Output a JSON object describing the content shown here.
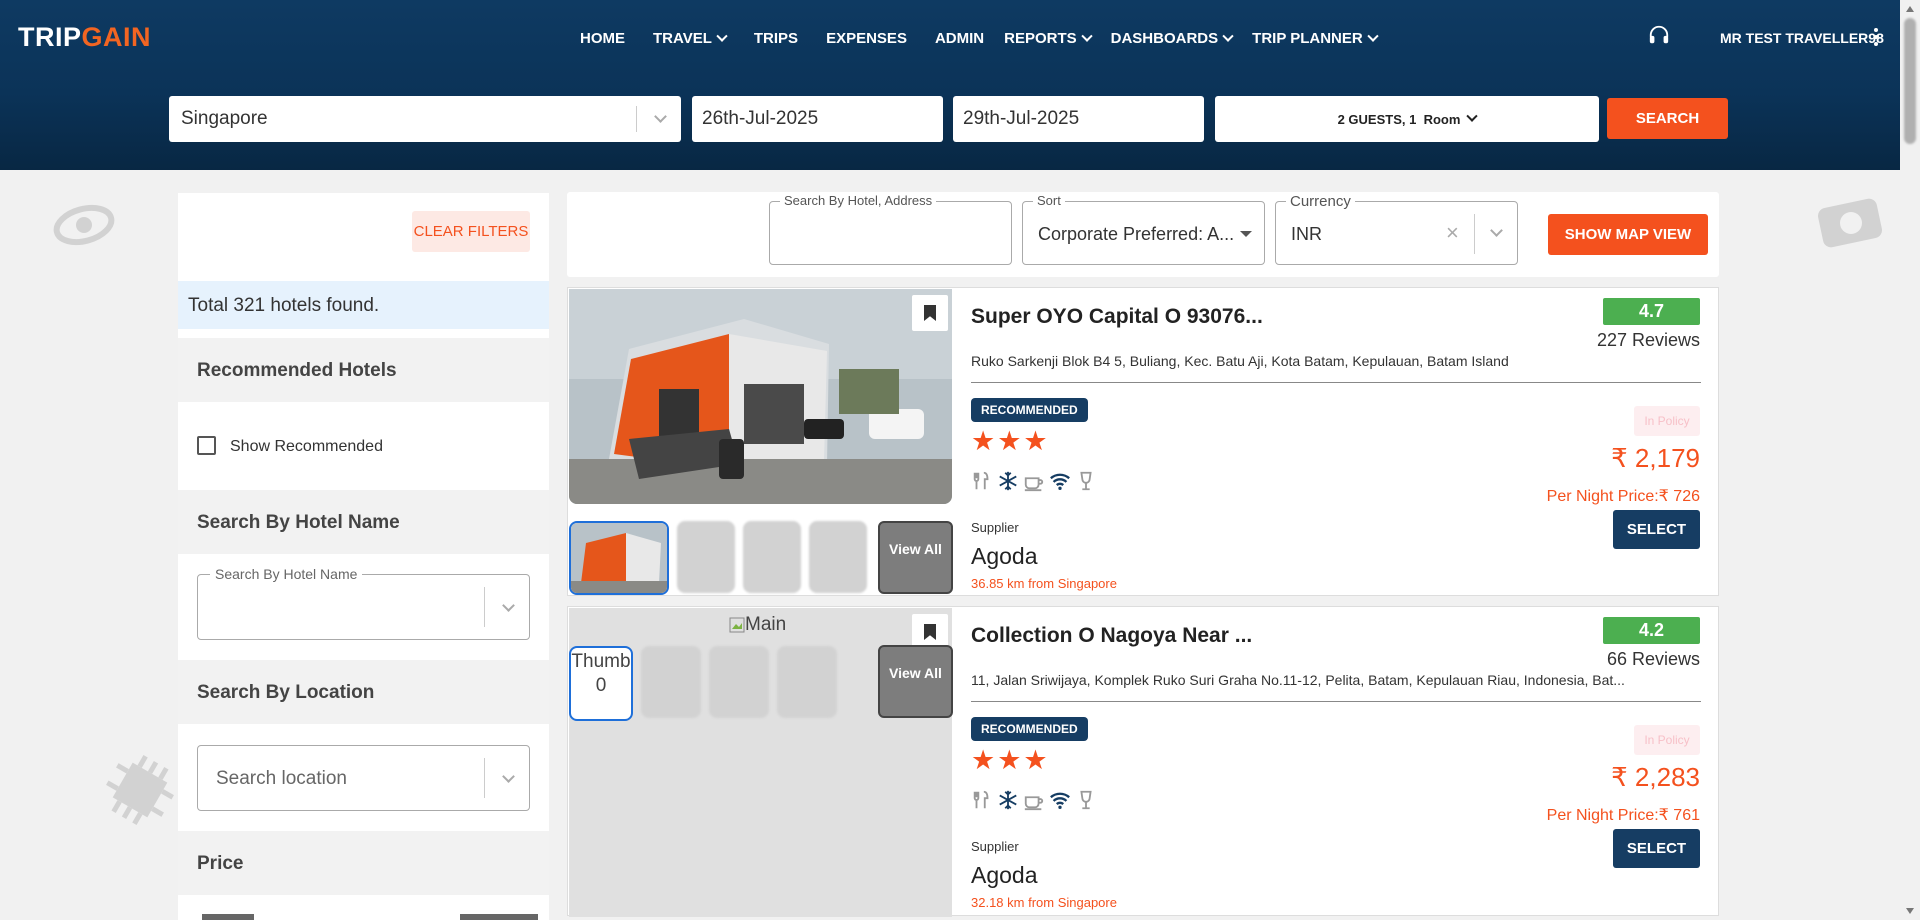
{
  "app": {
    "logo_trip": "TRIP",
    "logo_gain": "GAIN"
  },
  "nav": {
    "items": [
      {
        "label": "HOME",
        "dropdown": false
      },
      {
        "label": "TRAVEL",
        "dropdown": true
      },
      {
        "label": "TRIPS",
        "dropdown": false
      },
      {
        "label": "EXPENSES",
        "dropdown": false
      },
      {
        "label": "ADMIN",
        "dropdown": false
      },
      {
        "label": "REPORTS",
        "dropdown": true
      },
      {
        "label": "DASHBOARDS",
        "dropdown": true
      },
      {
        "label": "TRIP PLANNER",
        "dropdown": true
      }
    ],
    "user": "MR TEST TRAVELLER98"
  },
  "search": {
    "city": "Singapore",
    "checkin": "26th-Jul-2025",
    "checkout": "29th-Jul-2025",
    "guests": "2 GUESTS, 1",
    "room": "Room",
    "button": "SEARCH"
  },
  "sidebar": {
    "clear_filters": "CLEAR FILTERS",
    "total": "Total 321 hotels found.",
    "recommended_title": "Recommended Hotels",
    "show_recommended": "Show Recommended",
    "hotel_name_title": "Search By Hotel Name",
    "hotel_name_legend": "Search By Hotel Name",
    "location_title": "Search By Location",
    "location_placeholder": "Search location",
    "price_title": "Price"
  },
  "filters": {
    "search_legend": "Search By Hotel, Address",
    "sort_legend": "Sort",
    "sort_value": "Corporate Preferred: A...",
    "currency_legend": "Currency",
    "currency_value": "INR",
    "map_button": "SHOW MAP VIEW"
  },
  "hotels": [
    {
      "name": "Super OYO Capital O 93076...",
      "address": "Ruko Sarkenji Blok B4 5, Buliang, Kec. Batu Aji, Kota Batam, Kepulauan, Batam Island",
      "rating": "4.7",
      "reviews": "227 Reviews",
      "badge": "RECOMMENDED",
      "stars": "★★★",
      "policy": "In Policy",
      "price": "₹ 2,179",
      "per_night": "Per Night Price:₹ 726",
      "select": "SELECT",
      "supplier_label": "Supplier",
      "supplier": "Agoda",
      "distance": "36.85 km from Singapore",
      "view_all": "View All"
    },
    {
      "name": "Collection O Nagoya Near ...",
      "address": "11, Jalan Sriwijaya, Komplek Ruko Suri Graha No.11-12, Pelita, Batam, Kepulauan Riau, Indonesia, Bat...",
      "rating": "4.2",
      "reviews": "66 Reviews",
      "badge": "RECOMMENDED",
      "stars": "★★★",
      "policy": "In Policy",
      "price": "₹ 2,283",
      "per_night": "Per Night Price:₹ 761",
      "select": "SELECT",
      "supplier_label": "Supplier",
      "supplier": "Agoda",
      "distance": "32.18 km from Singapore",
      "view_all": "View All",
      "main_alt": "Main",
      "thumb_alt": "Thumb 0"
    }
  ],
  "colors": {
    "header": "#0b3358",
    "accent": "#f4511e",
    "navy": "#163d63",
    "rating": "#4caf50"
  },
  "icons": [
    "headset-icon",
    "kebab-menu-icon",
    "chevron-down-icon",
    "bookmark-icon",
    "restaurant-icon",
    "ac-icon",
    "coffee-icon",
    "wifi-icon",
    "bar-icon"
  ]
}
